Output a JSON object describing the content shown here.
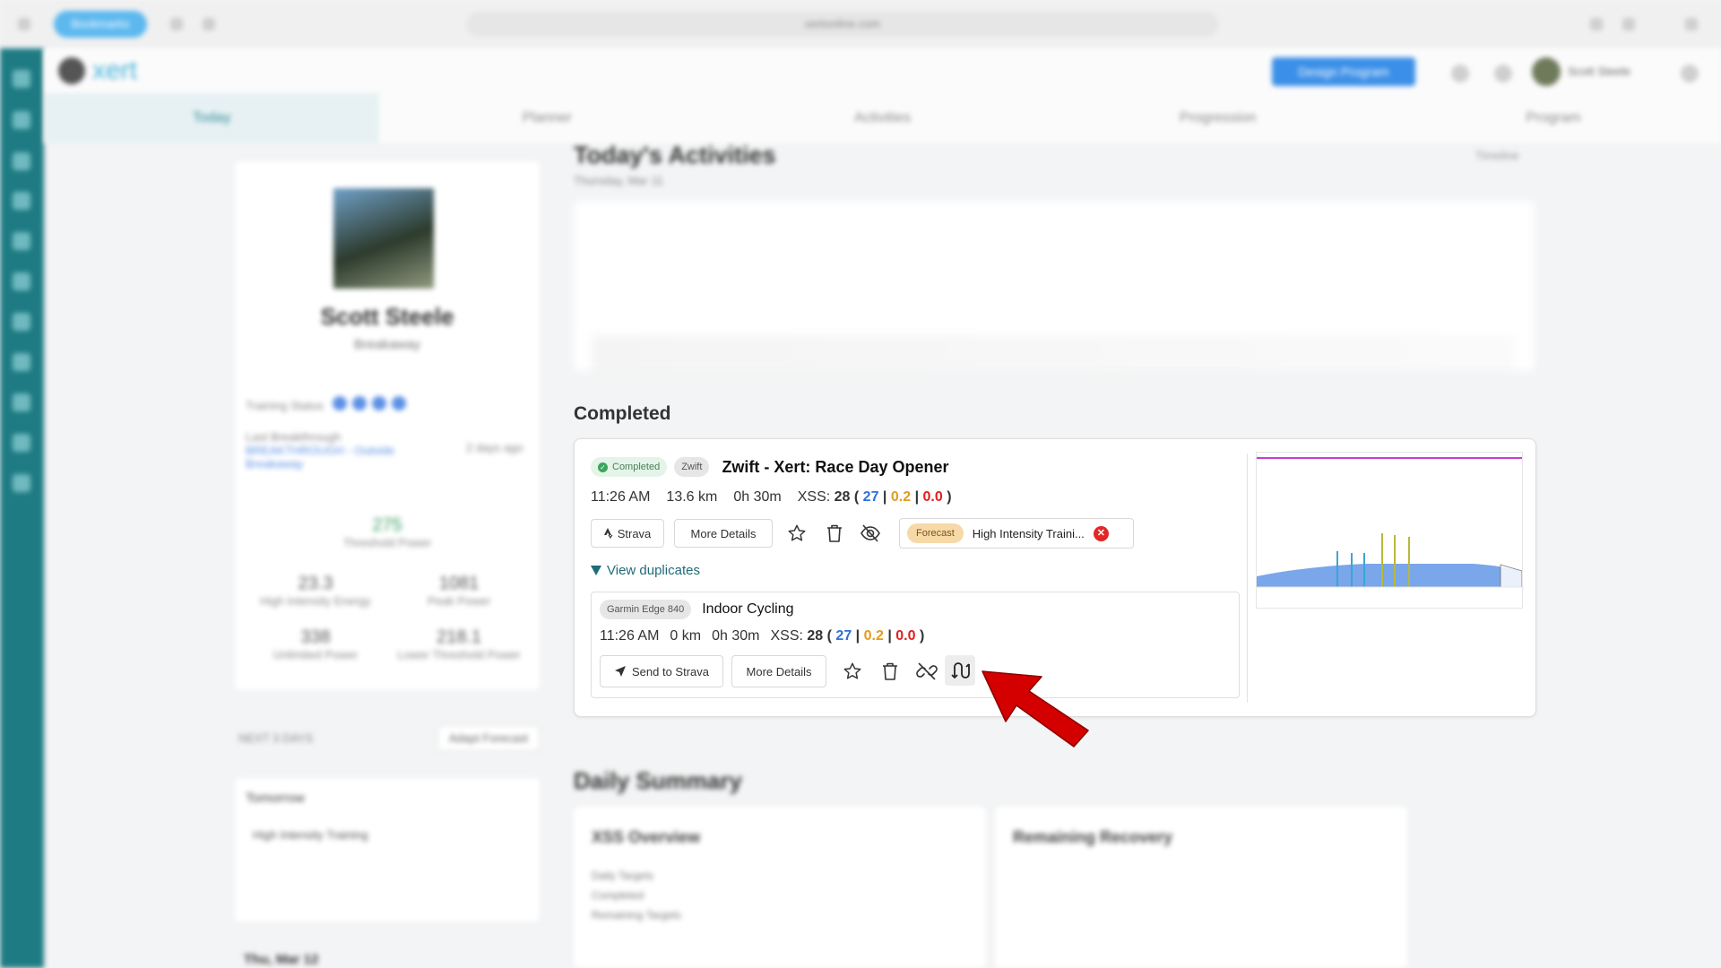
{
  "browser": {
    "pill": "Bookmarks",
    "url": "xertonline.com"
  },
  "header": {
    "logo_text": "xert",
    "design_button": "Design Program",
    "user_name": "Scott Steele"
  },
  "tabs": [
    "Today",
    "Planner",
    "Activities",
    "Progression",
    "Program"
  ],
  "profile": {
    "name": "Scott Steele",
    "role": "Breakaway",
    "training_status_label": "Training Status",
    "last_breakthrough_label": "Last Breakthrough",
    "last_breakthrough_value": "BREAKTHROUGH - Outside Breakaway",
    "last_breakthrough_meta": "2 days ago",
    "ftp_value": "275",
    "ftp_label": "Threshold Power",
    "stats": [
      {
        "value": "23.3",
        "label": "High Intensity Energy"
      },
      {
        "value": "1081",
        "label": "Peak Power"
      },
      {
        "value": "338",
        "label": "Unlimited Power"
      },
      {
        "value": "218.1",
        "label": "Lower Threshold Power"
      }
    ],
    "next_label": "NEXT 3 DAYS",
    "adapt_button": "Adapt Forecast",
    "tomorrow_label": "Tomorrow",
    "tomorrow_item": "High Intensity Training",
    "upcoming_date": "Thu, Mar 12"
  },
  "today": {
    "title": "Today's Activities",
    "subtitle": "Thursday, Mar 11",
    "link": "Timeline"
  },
  "completed": {
    "section_title": "Completed",
    "activity": {
      "status_badge": "Completed",
      "source_badge": "Zwift",
      "title": "Zwift - Xert: Race Day Opener",
      "time": "11:26 AM",
      "distance": "13.6 km",
      "duration": "0h 30m",
      "xss_label": "XSS:",
      "xss_total": "28",
      "xss_low": "27",
      "xss_high": "0.2",
      "xss_peak": "0.0",
      "strava_button": "Strava",
      "details_button": "More Details",
      "forecast_badge": "Forecast",
      "forecast_name": "High Intensity Traini...",
      "view_duplicates": "View duplicates"
    },
    "duplicate": {
      "device_badge": "Garmin Edge 840",
      "title": "Indoor Cycling",
      "time": "11:26 AM",
      "distance": "0 km",
      "duration": "0h 30m",
      "xss_label": "XSS:",
      "xss_total": "28",
      "xss_low": "27",
      "xss_high": "0.2",
      "xss_peak": "0.0",
      "send_button": "Send to Strava",
      "details_button": "More Details"
    }
  },
  "daily_summary": {
    "title": "Daily Summary",
    "xss_overview": "XSS Overview",
    "remaining_recovery": "Remaining Recovery",
    "rows": [
      "Daily Targets",
      "Completed",
      "Remaining Targets"
    ]
  },
  "colors": {
    "rail": "#1e7b83",
    "low": "#2f72d8",
    "high": "#e39b1f",
    "peak": "#e02020",
    "arrow": "#d40000"
  }
}
